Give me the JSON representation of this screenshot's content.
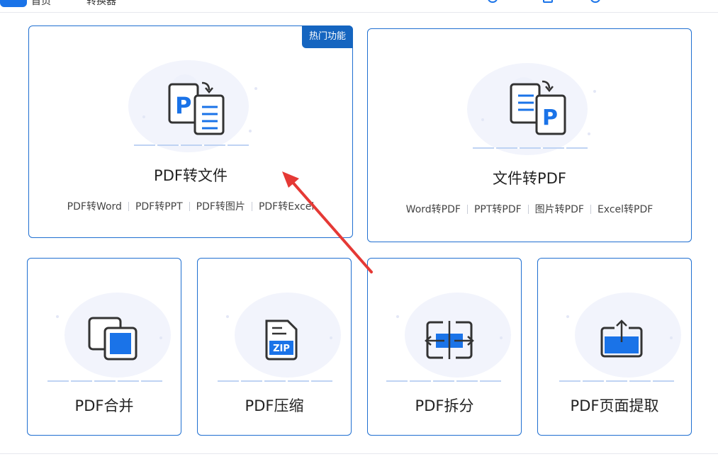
{
  "topbar": {
    "left_text": "首页",
    "mid_text": "转换器"
  },
  "main": {
    "cards_big": [
      {
        "title": "PDF转文件",
        "badge": "热门功能",
        "links": [
          "PDF转Word",
          "PDF转PPT",
          "PDF转图片",
          "PDF转Excel"
        ],
        "icon": "pdf-to-file-icon"
      },
      {
        "title": "文件转PDF",
        "links": [
          "Word转PDF",
          "PPT转PDF",
          "图片转PDF",
          "Excel转PDF"
        ],
        "icon": "file-to-pdf-icon"
      }
    ],
    "cards_small": [
      {
        "title": "PDF合并",
        "icon": "merge-icon"
      },
      {
        "title": "PDF压缩",
        "icon": "zip-icon",
        "icon_text": "ZIP"
      },
      {
        "title": "PDF拆分",
        "icon": "split-icon"
      },
      {
        "title": "PDF页面提取",
        "icon": "extract-icon"
      }
    ],
    "pdf_letter": "P"
  },
  "colors": {
    "accent": "#1a73e8",
    "border": "#1f6fd1",
    "badge": "#1565c0",
    "arrow": "#e53935",
    "icon_stroke": "#333333"
  }
}
